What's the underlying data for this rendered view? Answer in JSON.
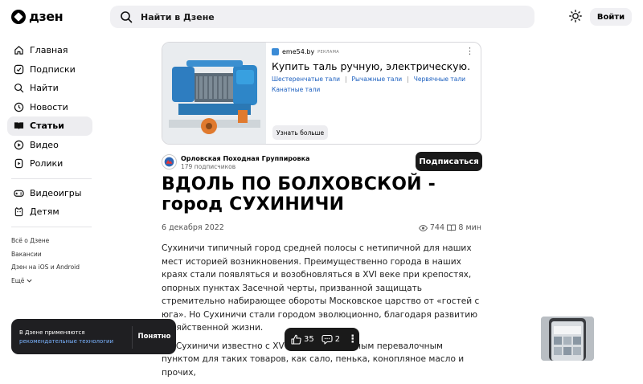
{
  "header": {
    "logo_text": "дзен",
    "search_placeholder": "Найти в Дзене",
    "login_label": "Войти"
  },
  "sidebar": {
    "items": [
      {
        "label": "Главная",
        "icon": "home-icon"
      },
      {
        "label": "Подписки",
        "icon": "subscriptions-icon"
      },
      {
        "label": "Найти",
        "icon": "search-icon"
      },
      {
        "label": "Новости",
        "icon": "news-icon"
      },
      {
        "label": "Статьи",
        "icon": "articles-icon",
        "active": true
      },
      {
        "label": "Видео",
        "icon": "video-icon"
      },
      {
        "label": "Ролики",
        "icon": "shorts-icon"
      }
    ],
    "items2": [
      {
        "label": "Видеоигры",
        "icon": "gamepad-icon"
      },
      {
        "label": "Детям",
        "icon": "kids-icon"
      }
    ],
    "links": [
      "Всё о Дзене",
      "Вакансии",
      "Дзен на iOS и Android",
      "Ещё"
    ]
  },
  "ad": {
    "source": "eme54.by",
    "tag": "РЕКЛАМА",
    "title": "Купить таль ручную, электрическую.",
    "links": [
      "Шестеренчатые тали",
      "Рычажные тали",
      "Червячные тали",
      "Канатные тали"
    ],
    "cta": "Узнать больше"
  },
  "channel": {
    "name": "Орловская Походная Группировка",
    "subscribers": "179 подписчиков",
    "subscribe_label": "Подписаться"
  },
  "article": {
    "title": "ВДОЛЬ ПО БОЛХОВСКОЙ - город СУХИНИЧИ",
    "date": "6 декабря 2022",
    "views": "744",
    "read_time": "8 мин",
    "paragraph1": "Сухиничи типичный город средней полосы с нетипичной для наших мест историей возникновения. Преимущественно города в наших краях стали появляться и возобновляться в XVI веке при крепостях, опорных пунктах Засечной черты, призванной защищать стремительно набирающее обороты Московское царство от «гостей с юга». Но Сухиничи стали городом эволюционно, благодаря развитию хозяйственной жизни.",
    "paragraph2": "Но Сухиничи известно с XV в. как оживлённым перевалочным пунктом для таких товаров, как сало, пенька, конопляное масло и прочих,"
  },
  "cookie": {
    "text": "В Дзене применяются",
    "link": "рекомендательные технологии",
    "ok_label": "Понятно"
  },
  "actions": {
    "likes": "35",
    "comments": "2"
  }
}
